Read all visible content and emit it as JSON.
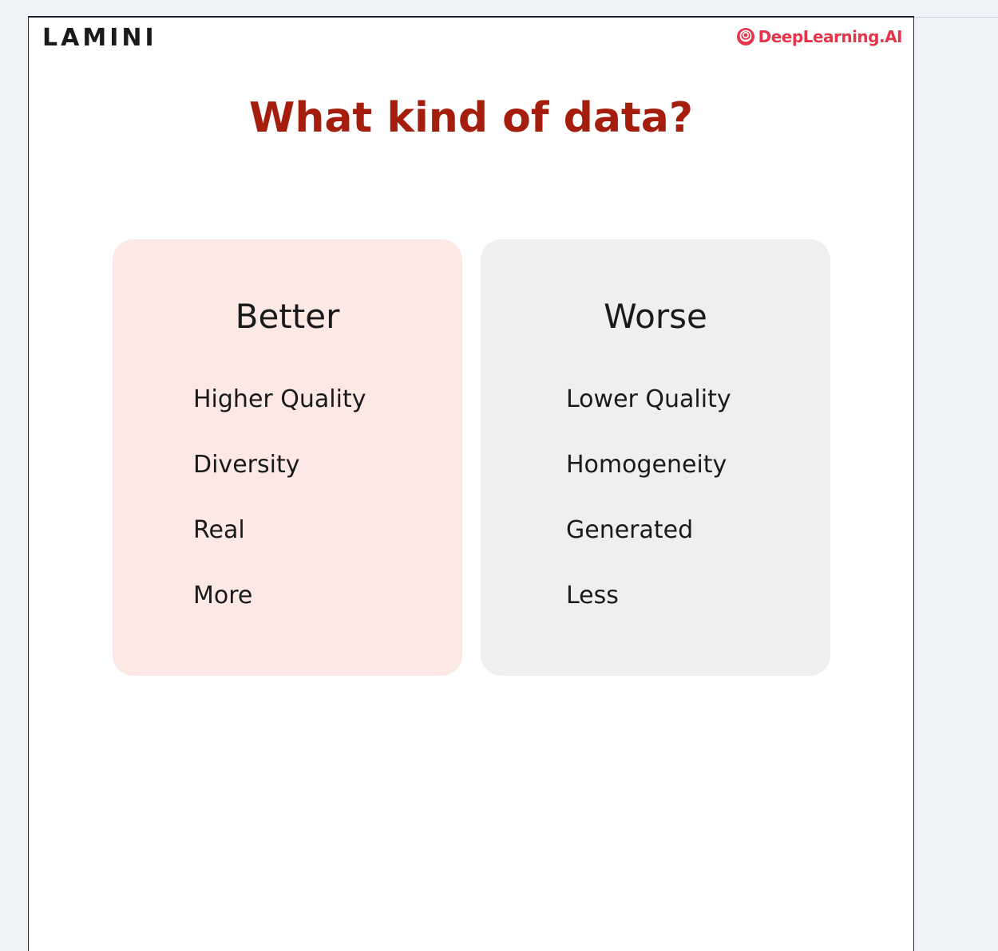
{
  "header": {
    "left_logo": "LAMINI",
    "right_logo": "DeepLearning.AI"
  },
  "title": "What kind of data?",
  "colors": {
    "title": "#a51d0c",
    "brand_red": "#e5354a",
    "better_card": "#fce9e3",
    "worse_card": "#f1eeee"
  },
  "icons": [
    "deeplearning-ai-logo-icon"
  ],
  "columns": {
    "better": {
      "heading": "Better",
      "items": [
        "Higher Quality",
        "Diversity",
        "Real",
        "More"
      ]
    },
    "worse": {
      "heading": "Worse",
      "items": [
        "Lower Quality",
        "Homogeneity",
        "Generated",
        "Less"
      ]
    }
  }
}
